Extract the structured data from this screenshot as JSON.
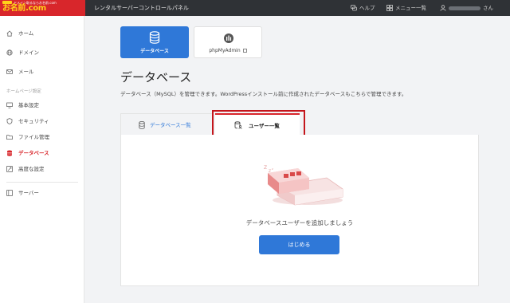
{
  "brand": {
    "tagline": "ドメイン取るならお名前.com",
    "name": "お名前.com"
  },
  "header": {
    "app_title": "レンタルサーバーコントロールパネル",
    "help_label": "ヘルプ",
    "menu_label": "メニュー一覧",
    "user_suffix": "さん"
  },
  "sidebar": {
    "items_top": [
      {
        "label": "ホーム",
        "icon": "home-icon"
      },
      {
        "label": "ドメイン",
        "icon": "globe-icon"
      },
      {
        "label": "メール",
        "icon": "mail-icon"
      }
    ],
    "section_label": "ホームページ設定",
    "items_site": [
      {
        "label": "基本設定",
        "icon": "monitor-icon"
      },
      {
        "label": "セキュリティ",
        "icon": "shield-icon"
      },
      {
        "label": "ファイル管理",
        "icon": "folder-icon"
      },
      {
        "label": "データベース",
        "icon": "database-icon",
        "active": true
      },
      {
        "label": "高度な設定",
        "icon": "settings-icon"
      }
    ],
    "items_bottom": [
      {
        "label": "サーバー",
        "icon": "server-icon"
      }
    ]
  },
  "main": {
    "cards": [
      {
        "label": "データベース",
        "icon": "database-icon",
        "active": true
      },
      {
        "label": "phpMyAdmin",
        "icon": "phpmyadmin-icon",
        "external": true
      }
    ],
    "title": "データベース",
    "description": "データベース（MySQL）を管理できます。WordPressインストール前に作成されたデータベースもこちらで管理できます。",
    "tabs": [
      {
        "label": "データベース一覧",
        "icon": "database-icon"
      },
      {
        "label": "ユーザー一覧",
        "icon": "user-list-icon",
        "active": true
      }
    ],
    "empty_message": "データベースユーザーを追加しましょう",
    "start_button": "はじめる"
  },
  "colors": {
    "brand_red": "#d8262b",
    "accent_blue": "#2f78d8",
    "highlight_red": "#c4161c",
    "topbar": "#2f3236"
  }
}
